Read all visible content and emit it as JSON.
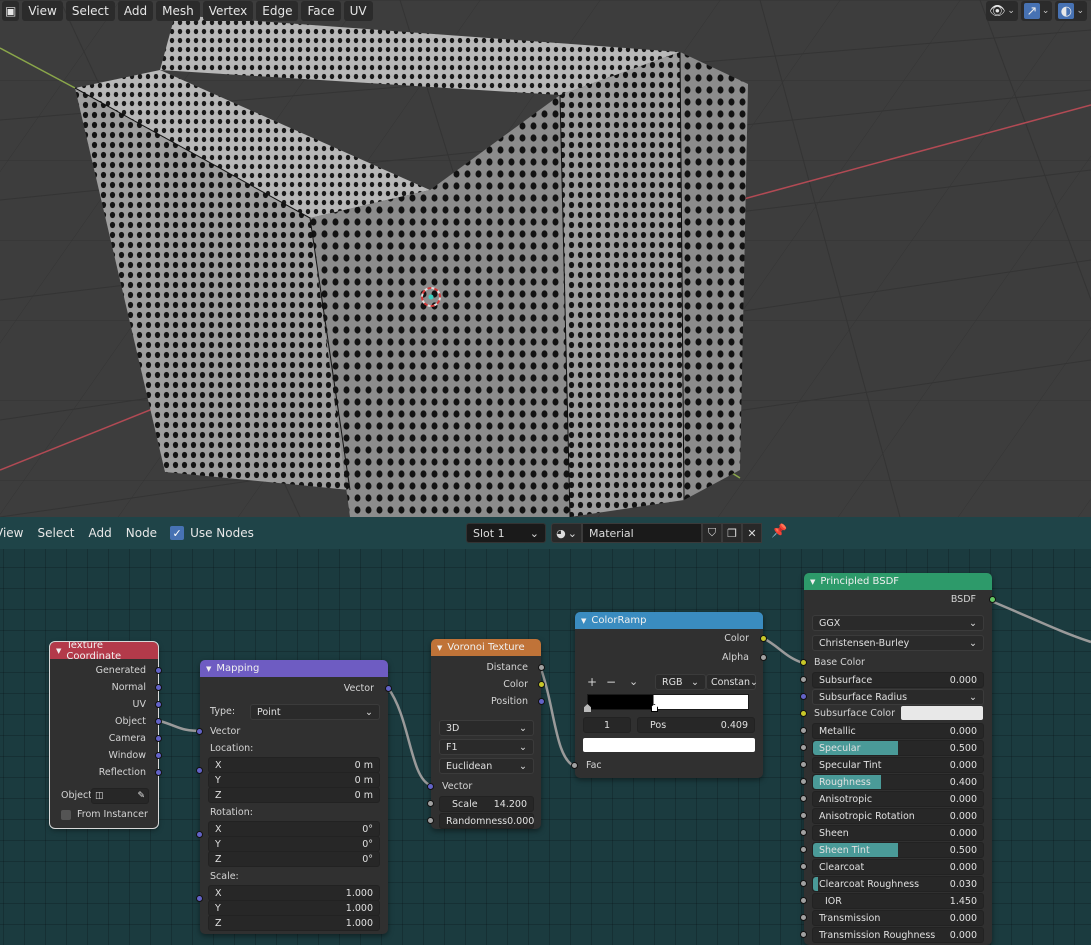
{
  "viewport": {
    "menu": [
      "View",
      "Select",
      "Add",
      "Mesh",
      "Vertex",
      "Edge",
      "Face",
      "UV"
    ],
    "header_icons": [
      "visibility-icon",
      "gizmo-icon",
      "overlay-icon"
    ]
  },
  "node_editor": {
    "menu": [
      "View",
      "Select",
      "Add",
      "Node"
    ],
    "use_nodes_label": "Use Nodes",
    "slot": "Slot 1",
    "material_name": "Material"
  },
  "nodes": {
    "texcoord": {
      "title": "Texture Coordinate",
      "outputs": [
        "Generated",
        "Normal",
        "UV",
        "Object",
        "Camera",
        "Window",
        "Reflection"
      ],
      "object_label": "Object:",
      "from_instancer": "From Instancer"
    },
    "mapping": {
      "title": "Mapping",
      "output": "Vector",
      "type_label": "Type:",
      "type_value": "Point",
      "vector_in": "Vector",
      "location_label": "Location:",
      "location": [
        [
          "X",
          "0 m"
        ],
        [
          "Y",
          "0 m"
        ],
        [
          "Z",
          "0 m"
        ]
      ],
      "rotation_label": "Rotation:",
      "rotation": [
        [
          "X",
          "0°"
        ],
        [
          "Y",
          "0°"
        ],
        [
          "Z",
          "0°"
        ]
      ],
      "scale_label": "Scale:",
      "scale": [
        [
          "X",
          "1.000"
        ],
        [
          "Y",
          "1.000"
        ],
        [
          "Z",
          "1.000"
        ]
      ]
    },
    "voronoi": {
      "title": "Voronoi Texture",
      "outputs": [
        "Distance",
        "Color",
        "Position"
      ],
      "dims": "3D",
      "feature": "F1",
      "metric": "Euclidean",
      "vector_in": "Vector",
      "scale_label": "Scale",
      "scale_value": "14.200",
      "random_label": "Randomness",
      "random_value": "0.000"
    },
    "colorramp": {
      "title": "ColorRamp",
      "outputs": [
        "Color",
        "Alpha"
      ],
      "plus": "+",
      "minus": "−",
      "color_mode": "RGB",
      "interp": "Constan",
      "stop_index": "1",
      "pos_label": "Pos",
      "pos_value": "0.409",
      "fac_in": "Fac"
    },
    "bsdf": {
      "title": "Principled BSDF",
      "output": "BSDF",
      "distribution": "GGX",
      "subsurface_method": "Christensen-Burley",
      "base_color": "Base Color",
      "props": [
        {
          "label": "Subsurface",
          "value": "0.000",
          "fill": 0
        },
        {
          "label": "Subsurface Radius",
          "value": "",
          "fill": 0
        },
        {
          "label": "Subsurface Color",
          "value": "",
          "fill": 0
        },
        {
          "label": "Metallic",
          "value": "0.000",
          "fill": 0
        },
        {
          "label": "Specular",
          "value": "0.500",
          "fill": 0.5
        },
        {
          "label": "Specular Tint",
          "value": "0.000",
          "fill": 0
        },
        {
          "label": "Roughness",
          "value": "0.400",
          "fill": 0.4
        },
        {
          "label": "Anisotropic",
          "value": "0.000",
          "fill": 0
        },
        {
          "label": "Anisotropic Rotation",
          "value": "0.000",
          "fill": 0
        },
        {
          "label": "Sheen",
          "value": "0.000",
          "fill": 0
        },
        {
          "label": "Sheen Tint",
          "value": "0.500",
          "fill": 0.5
        },
        {
          "label": "Clearcoat",
          "value": "0.000",
          "fill": 0
        },
        {
          "label": "Clearcoat Roughness",
          "value": "0.030",
          "fill": 0.03
        },
        {
          "label": "IOR",
          "value": "1.450",
          "fill": 0
        },
        {
          "label": "Transmission",
          "value": "0.000",
          "fill": 0
        },
        {
          "label": "Transmission Roughness",
          "value": "0.000",
          "fill": 0
        }
      ]
    }
  },
  "colors": {
    "texcoord_header": "#b33a4a",
    "mapping_header": "#6e5cc2",
    "voronoi_header": "#c07338",
    "colorramp_header": "#3a8cc0",
    "bsdf_header": "#2d9a6a",
    "editor_bg": "#1b3b3f",
    "selection_outline": "#d8d8d8"
  }
}
